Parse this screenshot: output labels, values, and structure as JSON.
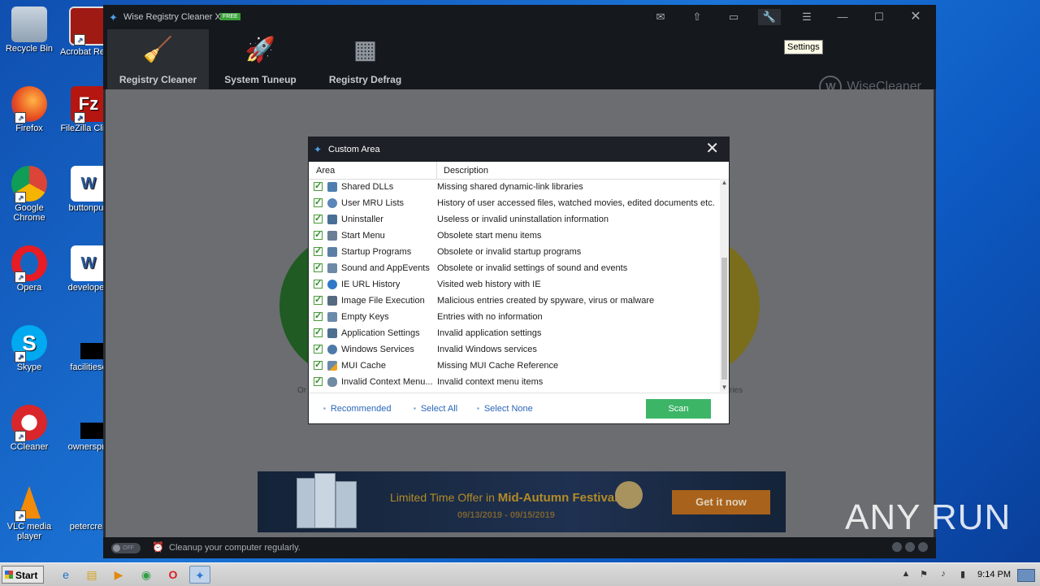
{
  "desktop": {
    "icons": [
      {
        "label": "Recycle Bin",
        "glyph": "🗑"
      },
      {
        "label": "Acrobat Reader DC",
        "glyph": "A"
      },
      {
        "label": "Firefox",
        "glyph": "🦊"
      },
      {
        "label": "FileZilla Client",
        "glyph": "Fz"
      },
      {
        "label": "Google Chrome",
        "glyph": "◉"
      },
      {
        "label": "buttonpub",
        "glyph": "W"
      },
      {
        "label": "Opera",
        "glyph": "O"
      },
      {
        "label": "developed",
        "glyph": "W"
      },
      {
        "label": "Skype",
        "glyph": "S"
      },
      {
        "label": "facilitieso",
        "glyph": ""
      },
      {
        "label": "CCleaner",
        "glyph": "C"
      },
      {
        "label": "ownerspm",
        "glyph": ""
      },
      {
        "label": "VLC media player",
        "glyph": "▲"
      },
      {
        "label": "petercrea",
        "glyph": ""
      }
    ]
  },
  "app": {
    "title": "Wise Registry Cleaner X",
    "badge": "FREE",
    "tabs": [
      {
        "label": "Registry Cleaner",
        "icon": "broom-icon"
      },
      {
        "label": "System Tuneup",
        "icon": "rocket-icon"
      },
      {
        "label": "Registry Defrag",
        "icon": "defrag-icon"
      }
    ],
    "brand": "WiseCleaner",
    "tooltip": "Settings",
    "behind_left_label": "Or",
    "behind_right_label": "ries",
    "banner": {
      "offer_prefix": "Limited Time Offer in ",
      "offer_highlight": "Mid-Autumn Festival!",
      "dates": "09/13/2019 - 09/15/2019",
      "cta": "Get it now"
    },
    "status": {
      "toggle": "OFF",
      "message": "Cleanup your computer regularly."
    }
  },
  "dialog": {
    "title": "Custom Area",
    "col_area": "Area",
    "col_desc": "Description",
    "rows": [
      {
        "area": "Shared DLLs",
        "desc": "Missing shared dynamic-link libraries"
      },
      {
        "area": "User MRU Lists",
        "desc": "History of user accessed files, watched movies, edited documents etc."
      },
      {
        "area": "Uninstaller",
        "desc": "Useless or invalid uninstallation information"
      },
      {
        "area": "Start Menu",
        "desc": "Obsolete start menu items"
      },
      {
        "area": "Startup Programs",
        "desc": "Obsolete or invalid startup programs"
      },
      {
        "area": "Sound and AppEvents",
        "desc": "Obsolete or invalid settings of sound and events"
      },
      {
        "area": "IE URL History",
        "desc": "Visited web history with IE"
      },
      {
        "area": "Image File Execution",
        "desc": "Malicious entries created by spyware, virus or malware"
      },
      {
        "area": "Empty Keys",
        "desc": "Entries with no information"
      },
      {
        "area": "Application Settings",
        "desc": "Invalid application settings"
      },
      {
        "area": "Windows Services",
        "desc": "Invalid Windows services"
      },
      {
        "area": "MUI Cache",
        "desc": "Missing MUI Cache Reference"
      },
      {
        "area": "Invalid Context Menu...",
        "desc": "Invalid context menu items"
      }
    ],
    "links": {
      "recommended": "Recommended",
      "select_all": "Select All",
      "select_none": "Select None"
    },
    "scan": "Scan"
  },
  "watermark": "ANY RUN",
  "taskbar": {
    "start": "Start",
    "clock": "9:14 PM"
  }
}
